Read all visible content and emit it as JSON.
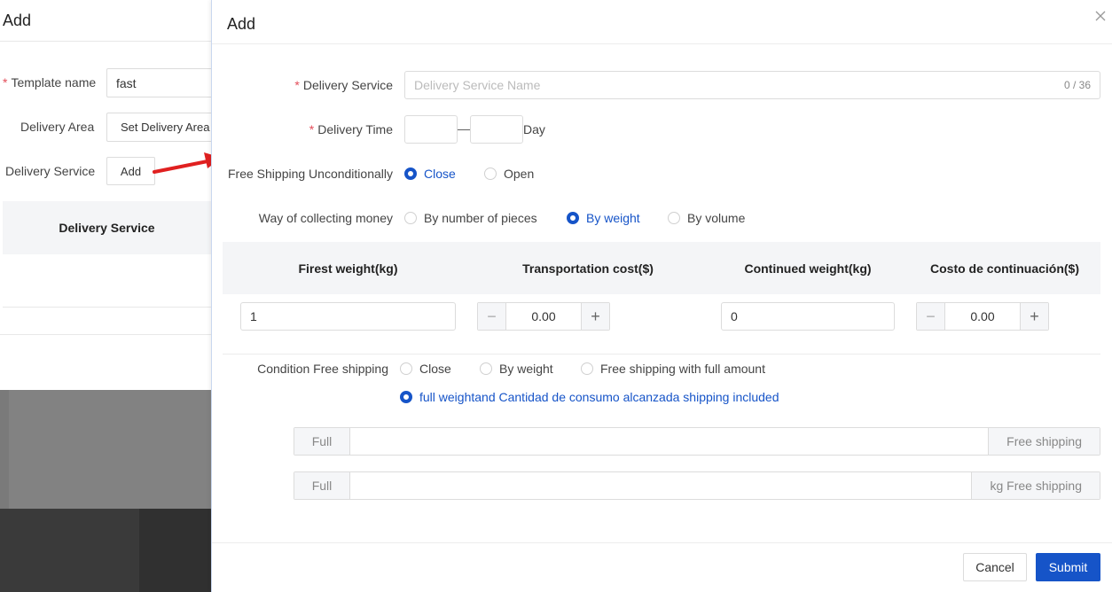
{
  "background_page": {
    "title": "Add",
    "template_name_label": "Template name",
    "template_name_value": "fast",
    "delivery_area_label": "Delivery Area",
    "delivery_area_button": "Set Delivery Area",
    "delivery_service_label": "Delivery Service",
    "add_button": "Add",
    "table_header": "Delivery Service"
  },
  "drawer": {
    "title": "Add",
    "delivery_service": {
      "label": "Delivery Service",
      "placeholder": "Delivery Service Name",
      "counter": "0 / 36"
    },
    "delivery_time": {
      "label": "Delivery Time",
      "separator": "—",
      "unit": "Day"
    },
    "free_shipping_unconditionally": {
      "label": "Free Shipping Unconditionally",
      "options": [
        "Close",
        "Open"
      ],
      "selected": "Close"
    },
    "way_of_collecting_money": {
      "label": "Way of collecting money",
      "options": [
        "By number of pieces",
        "By weight",
        "By volume"
      ],
      "selected": "By weight"
    },
    "weight_table": {
      "headers": [
        "Firest weight(kg)",
        "Transportation cost($)",
        "Continued weight(kg)",
        "Costo de continuación($)"
      ],
      "first_weight": "1",
      "transportation_cost": "0.00",
      "continued_weight": "0",
      "continuation_cost": "0.00"
    },
    "condition_free_shipping": {
      "label": "Condition Free shipping",
      "options": [
        "Close",
        "By weight",
        "Free shipping with full amount",
        "full weightand Cantidad de consumo alcanzada shipping included"
      ],
      "selected": "full weightand Cantidad de consumo alcanzada shipping included"
    },
    "full_rows": [
      {
        "prefix": "Full",
        "suffix": "Free shipping"
      },
      {
        "prefix": "Full",
        "suffix": "kg Free shipping"
      }
    ],
    "footer": {
      "cancel": "Cancel",
      "submit": "Submit"
    }
  },
  "colors": {
    "primary": "#1654c8",
    "required": "#e34d59",
    "arrow": "#e02020"
  }
}
